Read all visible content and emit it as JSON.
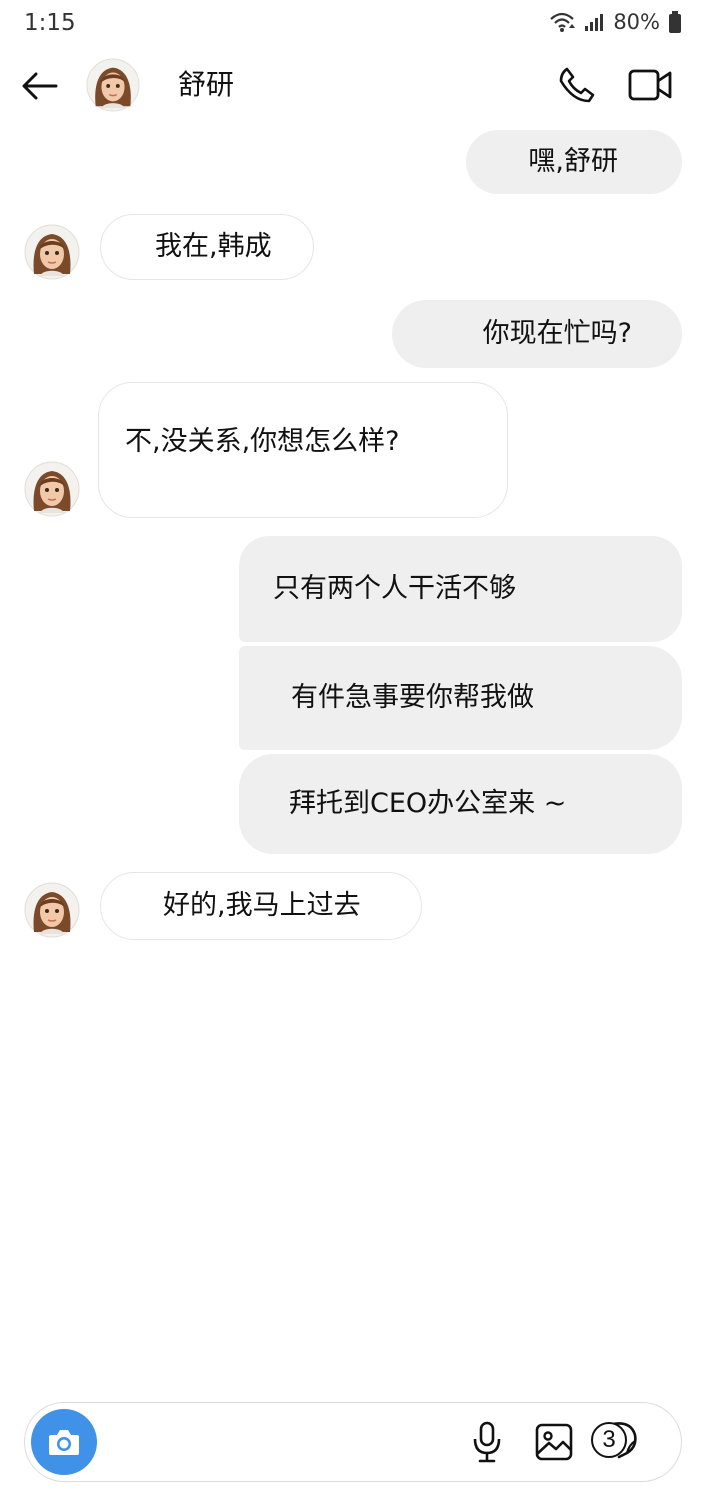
{
  "status_bar": {
    "time": "1:15",
    "battery": "80%",
    "icons": [
      "wifi-icon",
      "signal-icon",
      "battery-icon"
    ]
  },
  "header": {
    "contact_name": "舒研",
    "icons": [
      "back-arrow-icon",
      "phone-icon",
      "video-icon"
    ]
  },
  "messages": [
    {
      "direction": "out",
      "text": "嘿,舒研"
    },
    {
      "direction": "in",
      "text": "我在,韩成"
    },
    {
      "direction": "out",
      "text": "你现在忙吗?"
    },
    {
      "direction": "in",
      "text": "不,没关系,你想怎么样?"
    },
    {
      "direction": "out",
      "text": "只有两个人干活不够"
    },
    {
      "direction": "out",
      "text": "有件急事要你帮我做"
    },
    {
      "direction": "out",
      "text": "拜托到CEO办公室来 ~"
    },
    {
      "direction": "in",
      "text": "好的,我马上过去"
    }
  ],
  "composer": {
    "sticker_count": "3",
    "icons": [
      "camera-icon",
      "microphone-icon",
      "image-icon",
      "sticker-icon"
    ],
    "accent_color": "#3f92e8"
  }
}
